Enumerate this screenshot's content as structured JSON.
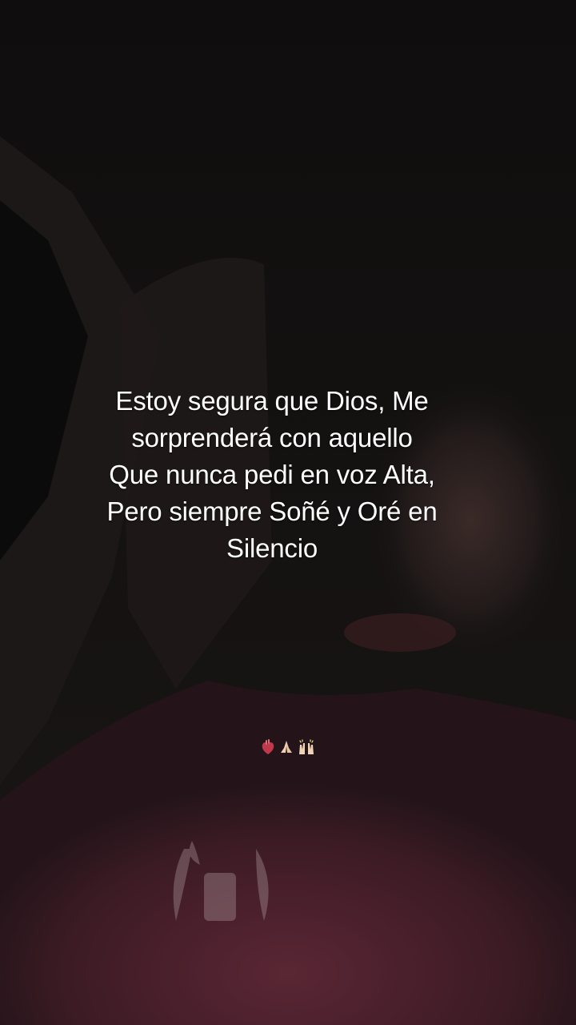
{
  "caption": {
    "line1": "Estoy segura que Dios, Me",
    "line2": "sorprenderá con aquello",
    "line3": "Que nunca pedi en voz Alta,",
    "line4": "Pero siempre Soñé y Oré en",
    "line5": "Silencio"
  },
  "emojis": [
    "anatomical-heart-icon",
    "folded-hands-icon",
    "raised-hands-icon"
  ],
  "colors": {
    "background": "#141111",
    "shirt": "#4a1f2a",
    "text": "#ffffff"
  }
}
